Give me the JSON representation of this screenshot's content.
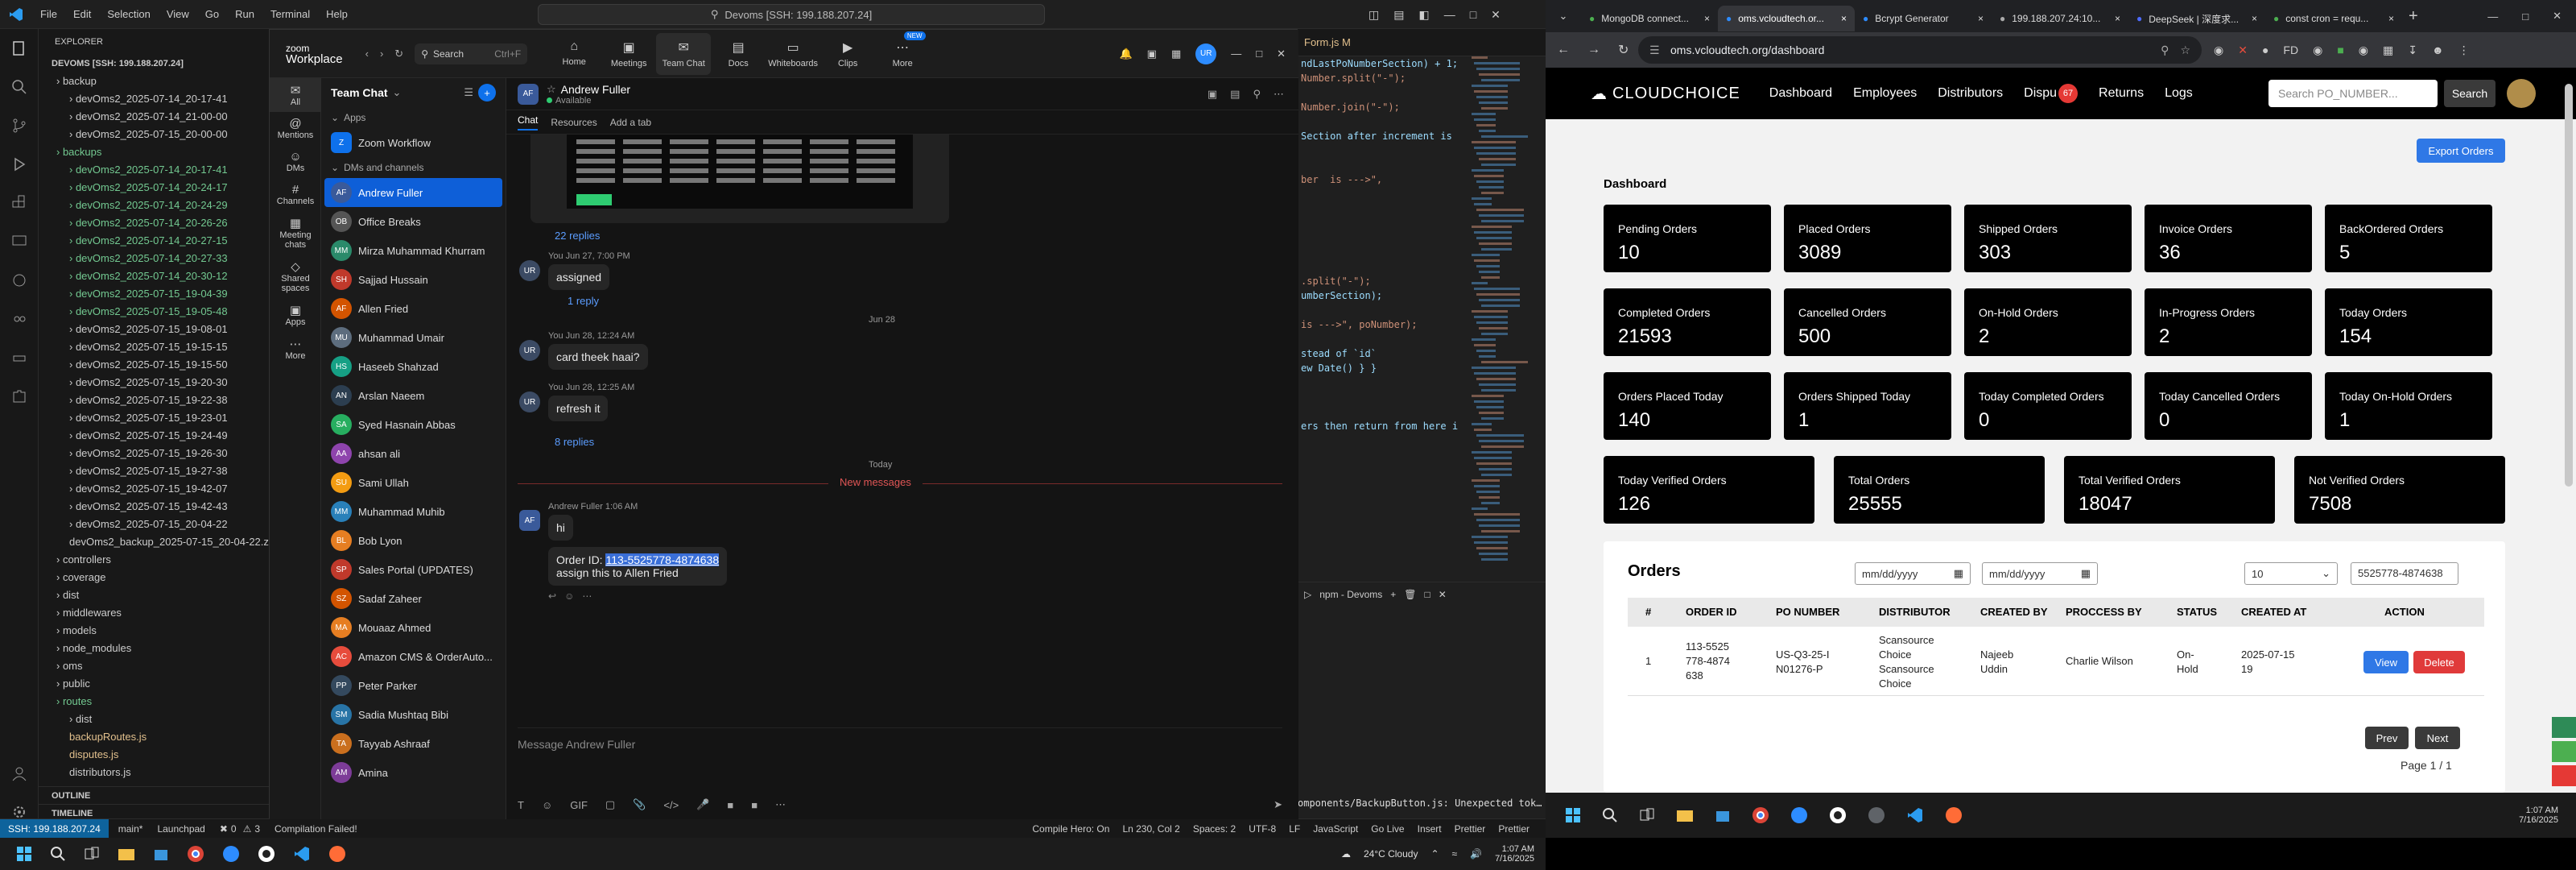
{
  "vscode": {
    "menu": [
      "File",
      "Edit",
      "Selection",
      "View",
      "Go",
      "Run",
      "Terminal",
      "Help"
    ],
    "command_center": "Devoms [SSH: 199.188.207.24]",
    "explorer_title": "EXPLORER",
    "root_folder": "DEVOMS [SSH: 199.188.207.24]",
    "tree": [
      {
        "t": "backup",
        "c": "folder",
        "d": 1
      },
      {
        "t": "devOms2_2025-07-14_20-17-41",
        "c": "folder",
        "d": 2
      },
      {
        "t": "devOms2_2025-07-14_21-00-00",
        "c": "folder",
        "d": 2
      },
      {
        "t": "devOms2_2025-07-15_20-00-00",
        "c": "folder",
        "d": 2
      },
      {
        "t": "backups",
        "c": "green",
        "d": 1
      },
      {
        "t": "devOms2_2025-07-14_20-17-41",
        "c": "green",
        "d": 2
      },
      {
        "t": "devOms2_2025-07-14_20-24-17",
        "c": "green",
        "d": 2
      },
      {
        "t": "devOms2_2025-07-14_20-24-29",
        "c": "green",
        "d": 2
      },
      {
        "t": "devOms2_2025-07-14_20-26-26",
        "c": "green",
        "d": 2
      },
      {
        "t": "devOms2_2025-07-14_20-27-15",
        "c": "green",
        "d": 2
      },
      {
        "t": "devOms2_2025-07-14_20-27-33",
        "c": "green",
        "d": 2
      },
      {
        "t": "devOms2_2025-07-14_20-30-12",
        "c": "green",
        "d": 2
      },
      {
        "t": "devOms2_2025-07-15_19-04-39",
        "c": "green",
        "d": 2
      },
      {
        "t": "devOms2_2025-07-15_19-05-48",
        "c": "green",
        "d": 2
      },
      {
        "t": "devOms2_2025-07-15_19-08-01",
        "c": "folder",
        "d": 2
      },
      {
        "t": "devOms2_2025-07-15_19-15-15",
        "c": "folder",
        "d": 2
      },
      {
        "t": "devOms2_2025-07-15_19-15-50",
        "c": "folder",
        "d": 2
      },
      {
        "t": "devOms2_2025-07-15_19-20-30",
        "c": "folder",
        "d": 2
      },
      {
        "t": "devOms2_2025-07-15_19-22-38",
        "c": "folder",
        "d": 2
      },
      {
        "t": "devOms2_2025-07-15_19-23-01",
        "c": "folder",
        "d": 2
      },
      {
        "t": "devOms2_2025-07-15_19-24-49",
        "c": "folder",
        "d": 2
      },
      {
        "t": "devOms2_2025-07-15_19-26-30",
        "c": "folder",
        "d": 2
      },
      {
        "t": "devOms2_2025-07-15_19-27-38",
        "c": "folder",
        "d": 2
      },
      {
        "t": "devOms2_2025-07-15_19-42-07",
        "c": "folder",
        "d": 2
      },
      {
        "t": "devOms2_2025-07-15_19-42-43",
        "c": "folder",
        "d": 2
      },
      {
        "t": "devOms2_2025-07-15_20-04-22",
        "c": "folder",
        "d": 2
      },
      {
        "t": "devOms2_backup_2025-07-15_20-04-22.z...",
        "c": "folder",
        "d": 2
      },
      {
        "t": "controllers",
        "c": "folder",
        "d": 1
      },
      {
        "t": "coverage",
        "c": "folder",
        "d": 1
      },
      {
        "t": "dist",
        "c": "folder",
        "d": 1
      },
      {
        "t": "middlewares",
        "c": "folder",
        "d": 1
      },
      {
        "t": "models",
        "c": "folder",
        "d": 1
      },
      {
        "t": "node_modules",
        "c": "folder",
        "d": 1
      },
      {
        "t": "oms",
        "c": "folder",
        "d": 1
      },
      {
        "t": "public",
        "c": "folder",
        "d": 1
      },
      {
        "t": "routes",
        "c": "green",
        "d": 1
      },
      {
        "t": "dist",
        "c": "folder",
        "d": 2
      },
      {
        "t": "backupRoutes.js",
        "c": "yellow",
        "d": 2
      },
      {
        "t": "disputes.js",
        "c": "yellow",
        "d": 2
      },
      {
        "t": "distributors.js",
        "c": "folder",
        "d": 2
      }
    ],
    "outline": "OUTLINE",
    "timeline": "TIMELINE",
    "editor_tab": "Form.js M",
    "code_lines": [
      "ndLastPoNumberSection) + 1;",
      "Number.split(\"-\");",
      "",
      "Number.join(\"-\");",
      "",
      "Section after increment is",
      "",
      "",
      "ber  is --->\",",
      "",
      "",
      "",
      "",
      "",
      "",
      ".split(\"-\");",
      "umberSection);",
      "",
      "is --->\", poNumber);",
      "",
      "stead of `id`",
      "ew Date() } }",
      "",
      "",
      "",
      "ers then return from here i"
    ],
    "terminal_label": "npm - Devoms",
    "terminal_text": "omponents/BackupButton.js: Unexpected token (1...",
    "status": {
      "remote": "SSH: 199.188.207.24",
      "branch": "main*",
      "launchpad": "Launchpad",
      "errors": "0",
      "warnings": "3",
      "compile": "Compilation Failed!",
      "compile_hero": "Compile Hero: On",
      "position": "Ln 230, Col 2",
      "spaces": "Spaces: 2",
      "encoding": "UTF-8",
      "eol": "LF",
      "language": "JavaScript",
      "golive": "Go Live",
      "insert": "Insert",
      "prettier": "Prettier",
      "prettier2": "Prettier"
    }
  },
  "taskbar_left": {
    "weather": "24°C Cloudy",
    "time": "1:07 AM",
    "date": "7/16/2025"
  },
  "zoom": {
    "logo_top": "zoom",
    "logo_bottom": "Workplace",
    "search": "Search",
    "search_shortcut": "Ctrl+F",
    "tabs": [
      "Home",
      "Meetings",
      "Team Chat",
      "Docs",
      "Whiteboards",
      "Clips",
      "More"
    ],
    "new_badge": "NEW",
    "avatar": "UR",
    "rail": [
      "All",
      "Mentions",
      "DMs",
      "Channels",
      "Meeting chats",
      "Shared spaces",
      "Apps",
      "More"
    ],
    "list_title": "Team Chat",
    "section_apps": "Apps",
    "section_dms": "DMs and channels",
    "zoom_workflow": "Zoom Workflow",
    "contacts": [
      {
        "name": "Andrew Fuller",
        "init": "AF",
        "color": "#3a5a9a",
        "sel": true
      },
      {
        "name": "Office Breaks",
        "init": "OB",
        "color": "#555"
      },
      {
        "name": "Mirza Muhammad Khurram",
        "init": "MM",
        "color": "#2a8a6a"
      },
      {
        "name": "Sajjad Hussain",
        "init": "SH",
        "color": "#c0392b"
      },
      {
        "name": "Allen Fried",
        "init": "AF",
        "color": "#d35400"
      },
      {
        "name": "Muhammad Umair",
        "init": "MU",
        "color": "#5d6d7e"
      },
      {
        "name": "Haseeb Shahzad",
        "init": "HS",
        "color": "#16a085"
      },
      {
        "name": "Arslan Naeem",
        "init": "AN",
        "color": "#2c3e50"
      },
      {
        "name": "Syed Hasnain Abbas",
        "init": "SA",
        "color": "#27ae60"
      },
      {
        "name": "ahsan ali",
        "init": "AA",
        "color": "#8e44ad"
      },
      {
        "name": "Sami Ullah",
        "init": "SU",
        "color": "#f39c12"
      },
      {
        "name": "Muhammad Muhib",
        "init": "MM",
        "color": "#2980b9"
      },
      {
        "name": "Bob Lyon",
        "init": "BL",
        "color": "#e67e22"
      },
      {
        "name": "Sales Portal (UPDATES)",
        "init": "SP",
        "color": "#c0392b"
      },
      {
        "name": "Sadaf Zaheer",
        "init": "SZ",
        "color": "#d35400"
      },
      {
        "name": "Mouaaz Ahmed",
        "init": "MA",
        "color": "#e67e22"
      },
      {
        "name": "Amazon CMS & OrderAuto...",
        "init": "AC",
        "color": "#e74c3c"
      },
      {
        "name": "Peter Parker",
        "init": "PP",
        "color": "#34495e"
      },
      {
        "name": "Sadia Mushtaq Bibi",
        "init": "SM",
        "color": "#2874a6"
      },
      {
        "name": "Tayyab Ashraaf",
        "init": "TA",
        "color": "#ca6f1e"
      },
      {
        "name": "Amina",
        "init": "AM",
        "color": "#7d3c98"
      }
    ],
    "chat_name": "Andrew Fuller",
    "chat_status": "Available",
    "chat_tabs": [
      "Chat",
      "Resources",
      "Add a tab"
    ],
    "messages": {
      "replies22": "22 replies",
      "m1_meta": "You Jun 27, 7:00 PM",
      "m1_text": "assigned",
      "reply1": "1 reply",
      "date_jun28": "Jun 28",
      "m2_meta": "You Jun 28, 12:24 AM",
      "m2_text": "card theek haai?",
      "m3_meta": "You Jun 28, 12:25 AM",
      "m3_text": "refresh it",
      "replies8": "8 replies",
      "today": "Today",
      "new_messages": "New messages",
      "m4_meta": "Andrew Fuller 1:06 AM",
      "m4_text": "hi",
      "m5_text1_prefix": "Order ID: ",
      "m5_text1_highlight": "113-5525778-4874638",
      "m5_text2": "assign this to Allen Fried"
    },
    "composer_placeholder": "Message Andrew Fuller"
  },
  "browser": {
    "tabs": [
      {
        "label": "MongoDB connect...",
        "active": false
      },
      {
        "label": "oms.vcloudtech.or...",
        "active": true
      },
      {
        "label": "Bcrypt Generator",
        "active": false
      },
      {
        "label": "199.188.207.24:10...",
        "active": false
      },
      {
        "label": "DeepSeek | 深度求...",
        "active": false
      },
      {
        "label": "const cron = requ...",
        "active": false
      }
    ],
    "url": "oms.vcloudtech.org/dashboard"
  },
  "oms": {
    "logo": "CLOUDCHOICE",
    "nav": [
      "Dashboard",
      "Employees",
      "Distributors",
      "Dispu",
      "Returns",
      "Logs"
    ],
    "disputes_badge": "67",
    "search_placeholder": "Search PO_NUMBER...",
    "search_button": "Search",
    "page_title": "Dashboard",
    "export_button": "Export Orders",
    "cards": [
      {
        "label": "Pending Orders",
        "value": "10"
      },
      {
        "label": "Placed Orders",
        "value": "3089"
      },
      {
        "label": "Shipped Orders",
        "value": "303"
      },
      {
        "label": "Invoice Orders",
        "value": "36"
      },
      {
        "label": "BackOrdered Orders",
        "value": "5"
      },
      {
        "label": "Completed Orders",
        "value": "21593"
      },
      {
        "label": "Cancelled Orders",
        "value": "500"
      },
      {
        "label": "On-Hold Orders",
        "value": "2"
      },
      {
        "label": "In-Progress Orders",
        "value": "2"
      },
      {
        "label": "Today Orders",
        "value": "154"
      },
      {
        "label": "Orders Placed Today",
        "value": "140"
      },
      {
        "label": "Orders Shipped Today",
        "value": "1"
      },
      {
        "label": "Today Completed Orders",
        "value": "0"
      },
      {
        "label": "Today Cancelled Orders",
        "value": "0"
      },
      {
        "label": "Today On-Hold Orders",
        "value": "1"
      }
    ],
    "cards_row4": [
      {
        "label": "Today Verified Orders",
        "value": "126"
      },
      {
        "label": "Total Orders",
        "value": "25555"
      },
      {
        "label": "Total Verified Orders",
        "value": "18047"
      },
      {
        "label": "Not Verified Orders",
        "value": "7508"
      }
    ],
    "orders_title": "Orders",
    "date_placeholder": "mm/dd/yyyy",
    "page_size": "10",
    "filter_value": "5525778-4874638",
    "columns": [
      "#",
      "ORDER ID",
      "PO NUMBER",
      "DISTRIBUTOR",
      "CREATED BY",
      "PROCCESS BY",
      "STATUS",
      "CREATED AT",
      "ACTION"
    ],
    "row": {
      "num": "1",
      "order_id": "113-5525778-4874638",
      "po": "US-Q3-25-IN01276-P",
      "distributor": "Scansource Choice Scansource Choice",
      "created_by": "Najeeb Uddin",
      "process_by": "Charlie Wilson",
      "status": "On-Hold",
      "created_at": "2025-07-15 19",
      "view": "View",
      "delete": "Delete"
    },
    "prev": "Prev",
    "next": "Next",
    "page_info": "Page 1 / 1"
  },
  "taskbar_right": {
    "time": "1:07 AM",
    "date": "7/16/2025"
  }
}
